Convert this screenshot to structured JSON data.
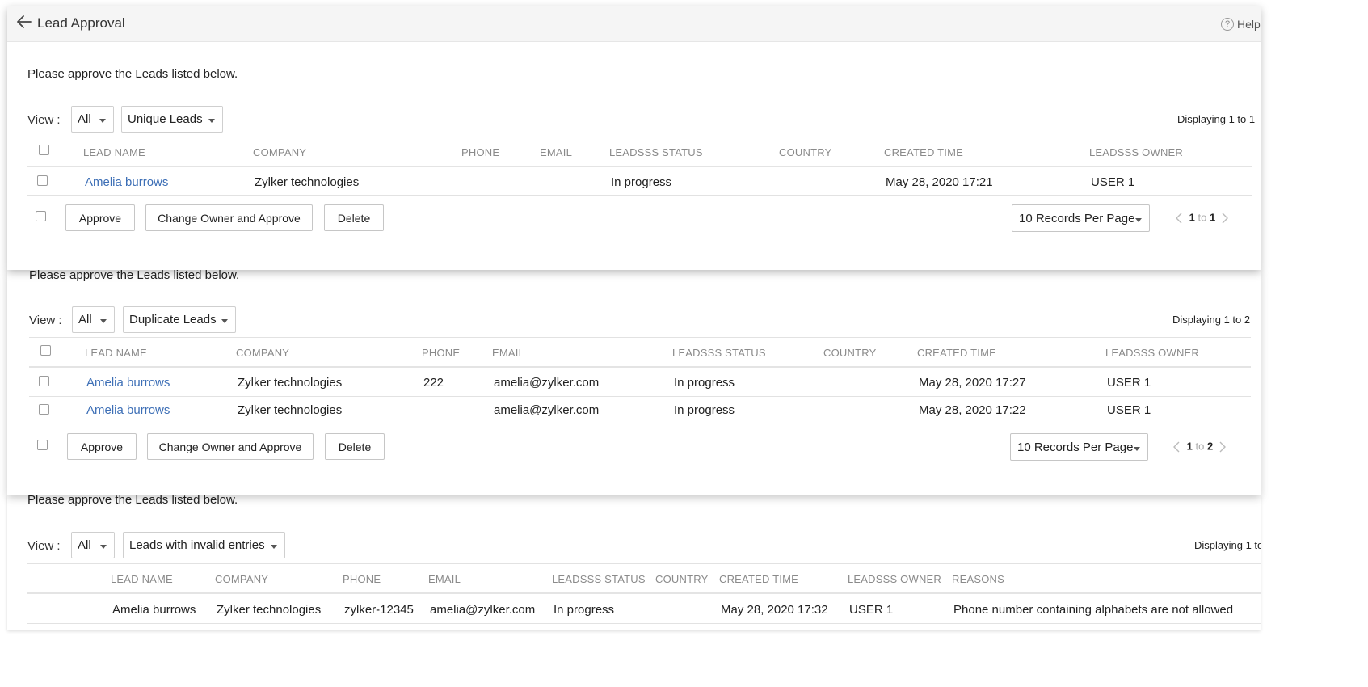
{
  "header": {
    "title": "Lead Approval",
    "help_label": "Help",
    "help_glyph": "?"
  },
  "sections": [
    {
      "instructions": "Please approve the Leads listed below.",
      "view_label": "View :",
      "filter_value": "All",
      "type_value": "Unique Leads",
      "displaying": "Displaying 1 to 1",
      "columns": [
        "LEAD NAME",
        "COMPANY",
        "PHONE",
        "EMAIL",
        "LEADSSS STATUS",
        "COUNTRY",
        "CREATED TIME",
        "LEADSSS OWNER"
      ],
      "rows": [
        [
          "Amelia burrows",
          "Zylker technologies",
          "",
          "",
          "In progress",
          "",
          "May 28, 2020 17:21",
          "USER 1"
        ]
      ],
      "actions": {
        "approve": "Approve",
        "change_owner": "Change Owner and Approve",
        "delete": "Delete"
      },
      "records_per_page": "10 Records Per Page",
      "pager": {
        "from": "1",
        "to_word": "to",
        "to": "1"
      }
    },
    {
      "instructions": "Please approve the Leads listed below.",
      "view_label": "View :",
      "filter_value": "All",
      "type_value": "Duplicate Leads",
      "displaying": "Displaying 1 to 2",
      "columns": [
        "LEAD NAME",
        "COMPANY",
        "PHONE",
        "EMAIL",
        "LEADSSS STATUS",
        "COUNTRY",
        "CREATED TIME",
        "LEADSSS OWNER"
      ],
      "rows": [
        [
          "Amelia burrows",
          "Zylker technologies",
          "222",
          "amelia@zylker.com",
          "In progress",
          "",
          "May 28, 2020 17:27",
          "USER 1"
        ],
        [
          "Amelia burrows",
          "Zylker technologies",
          "",
          "amelia@zylker.com",
          "In progress",
          "",
          "May 28, 2020 17:22",
          "USER 1"
        ]
      ],
      "actions": {
        "approve": "Approve",
        "change_owner": "Change Owner and Approve",
        "delete": "Delete"
      },
      "records_per_page": "10 Records Per Page",
      "pager": {
        "from": "1",
        "to_word": "to",
        "to": "2"
      }
    },
    {
      "instructions": "Please approve the Leads listed below.",
      "view_label": "View :",
      "filter_value": "All",
      "type_value": "Leads with invalid entries",
      "displaying": "Displaying 1 to",
      "columns": [
        "LEAD NAME",
        "COMPANY",
        "PHONE",
        "EMAIL",
        "LEADSSS STATUS",
        "COUNTRY",
        "CREATED TIME",
        "LEADSSS OWNER",
        "REASONS"
      ],
      "rows": [
        [
          "Amelia burrows",
          "Zylker technologies",
          "zylker-12345",
          "amelia@zylker.com",
          "In progress",
          "",
          "May 28, 2020 17:32",
          "USER 1",
          "Phone number containing alphabets are not allowed"
        ]
      ]
    }
  ]
}
